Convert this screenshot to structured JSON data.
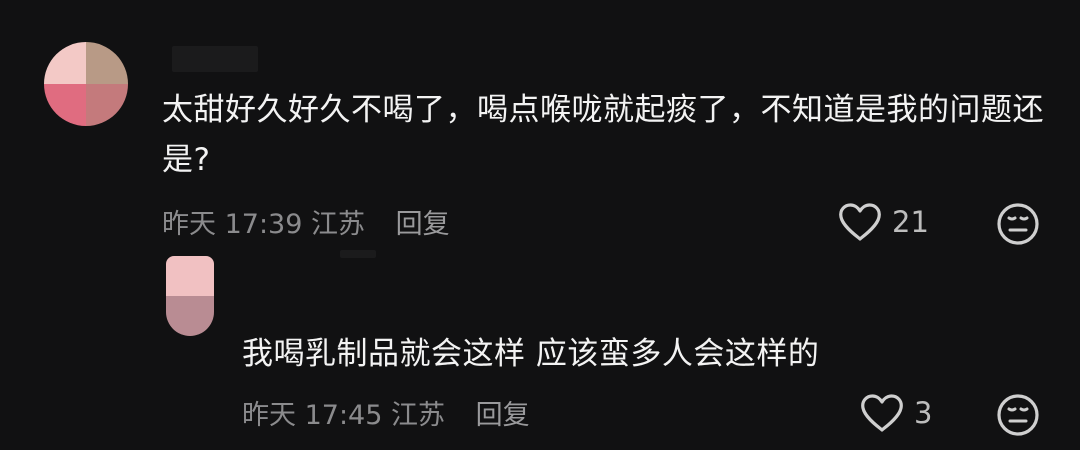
{
  "comments": [
    {
      "text": "太甜好久好久不喝了，喝点喉咙就起痰了，不知道是我的问题还是?",
      "time": "昨天 17:39",
      "location": "江苏",
      "reply_label": "回复",
      "likes": "21"
    },
    {
      "text": "我喝乳制品就会这样 应该蛮多人会这样的",
      "time": "昨天 17:45",
      "location": "江苏",
      "reply_label": "回复",
      "likes": "3"
    }
  ],
  "icons": {
    "like": "heart-icon",
    "dislike": "neutral-face-icon"
  }
}
